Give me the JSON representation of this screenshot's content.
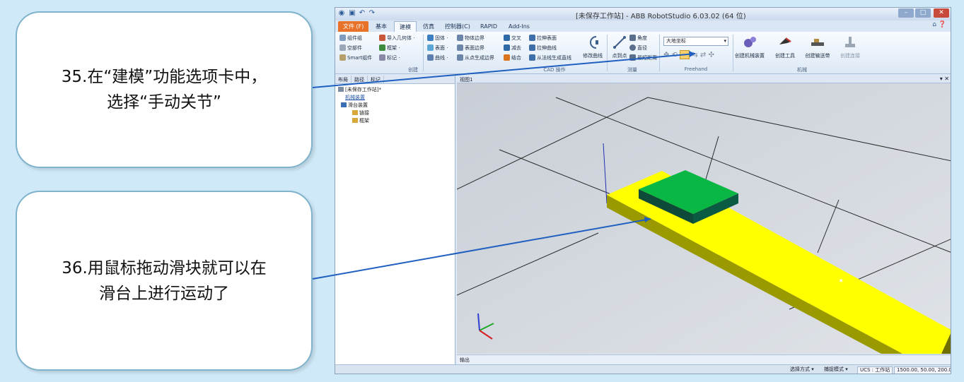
{
  "callouts": [
    {
      "text": "35.在“建模”功能选项卡中，\n选择“手动关节”"
    },
    {
      "text": "36.用鼠标拖动滑块就可以在\n滑台上进行运动了"
    }
  ],
  "app": {
    "title": "[未保存工作站] - ABB RobotStudio 6.03.02 (64 位)",
    "tabs": [
      "文件 (F)",
      "基本",
      "建模",
      "仿真",
      "控制器(C)",
      "RAPID",
      "Add-Ins"
    ],
    "active_tab": "建模",
    "ribbon": {
      "create": {
        "label": "创建",
        "items": [
          "组件组",
          "空部件",
          "Smart组件",
          "导入几何体 ·",
          "框架 ·",
          "标记 ·"
        ]
      },
      "cad": {
        "label": "CAD 操作",
        "items": [
          "固体 ·",
          "表面 ·",
          "曲线 ·",
          "物体边界",
          "表面边界",
          "从点生成边界",
          "交叉",
          "减去",
          "结合",
          "拉伸表面",
          "拉伸曲线",
          "从法线生成直线"
        ],
        "modify_curve": "修改曲线"
      },
      "measure": {
        "label": "测量",
        "items": [
          "点到点",
          "角度",
          "直径",
          "最短距离"
        ]
      },
      "freehand": {
        "label": "Freehand",
        "coord_select": "大地坐标"
      },
      "mechanism": {
        "label": "机械",
        "buttons": [
          "创建机械装置",
          "创建工具",
          "创建输送带",
          "创建连接"
        ]
      }
    },
    "left_pane": {
      "tabs": [
        "布局",
        "路径",
        "标记"
      ],
      "tree": [
        "[未保存工作站]*",
        "机械装置",
        "滑台装置",
        "链接",
        "框架"
      ]
    },
    "view": {
      "tab_label": "视图1"
    },
    "output_label": "输出",
    "status": [
      "选择方式 ▾",
      "捕捉模式 ▾",
      "UCS : 工作站",
      "1500.00, 50.00, 200.00"
    ]
  },
  "colors": {
    "slide": "#ffff00",
    "slider_block": "#09b844",
    "pointer_line": "#1f5fbf",
    "file_tab": "#e8722a"
  }
}
